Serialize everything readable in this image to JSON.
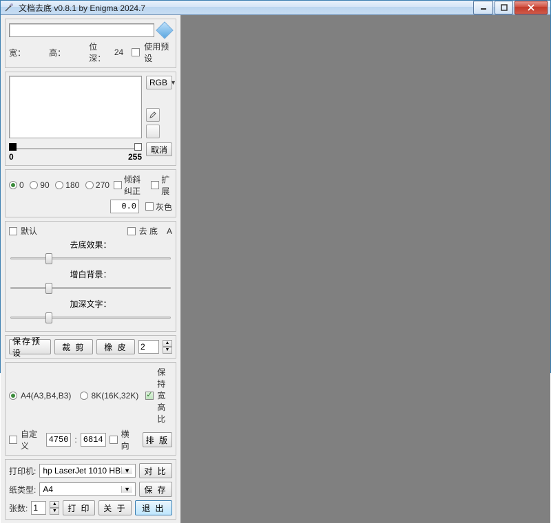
{
  "title": "文档去底        v0.8.1        by Enigma 2024.7",
  "dim": {
    "width_label": "宽：",
    "height_label": "高：",
    "depth_label": "位深：",
    "depth_value": "24",
    "use_preset": "使用预设"
  },
  "preview": {
    "colorspace": "RGB",
    "cancel": "取消",
    "hist_min": "0",
    "hist_max": "255"
  },
  "rotate": {
    "r0": "0",
    "r90": "90",
    "r180": "180",
    "r270": "270",
    "skew": "倾斜纠正",
    "skew_val": "0.0",
    "extend": "扩展",
    "gray": "灰色"
  },
  "effect": {
    "default": "默认",
    "remove_bg": "去 底",
    "a": "A",
    "s1": "去底效果：",
    "s2": "增白背景：",
    "s3": "加深文字："
  },
  "presets": {
    "save": "保存预设",
    "crop": "裁  剪",
    "eraser": "橡  皮",
    "count": "2"
  },
  "paper": {
    "a4": "A4(A3,B4,B3)",
    "k8": "8K(16K,32K)",
    "keep": "保持宽高比",
    "custom": "自定义",
    "w": "4750",
    "h": "6814",
    "orient": "横向",
    "layout": "排  版"
  },
  "print": {
    "printer_label": "打印机:",
    "printer_value": "hp LaserJet 1010 HB",
    "contrast": "对  比",
    "paper_label": "纸类型:",
    "paper_value": "A4",
    "save": "保  存",
    "copies_label": "张数:",
    "copies_value": "1",
    "print_btn": "打  印",
    "about": "关  于",
    "exit": "退    出"
  }
}
